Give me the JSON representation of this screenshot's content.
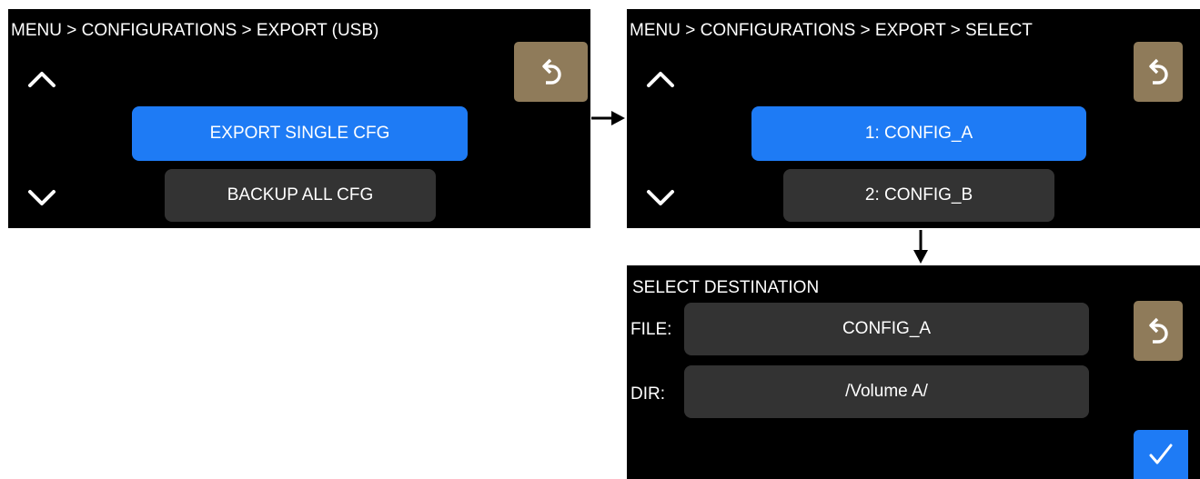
{
  "screens": [
    {
      "breadcrumb": "MENU > CONFIGURATIONS > EXPORT (USB)",
      "options": [
        {
          "label": "EXPORT SINGLE CFG",
          "selected": true
        },
        {
          "label": "BACKUP ALL CFG",
          "selected": false
        }
      ]
    },
    {
      "breadcrumb": "MENU > CONFIGURATIONS > EXPORT > SELECT",
      "options": [
        {
          "label": "1: CONFIG_A",
          "selected": true
        },
        {
          "label": "2: CONFIG_B",
          "selected": false
        }
      ]
    },
    {
      "title": "SELECT DESTINATION",
      "file_label": "FILE:",
      "file_value": "CONFIG_A",
      "dir_label": "DIR:",
      "dir_value": "/Volume A/"
    }
  ],
  "colors": {
    "selected": "#1e7bf5",
    "unselected": "#333333",
    "back_button": "#8f7b5a",
    "screen_background": "#000000"
  },
  "icons": {
    "up": "chevron-up-icon",
    "down": "chevron-down-icon",
    "back": "undo-arrow-icon",
    "confirm": "checkmark-icon",
    "flow_right": "arrow-right-icon",
    "flow_down": "arrow-down-icon"
  }
}
